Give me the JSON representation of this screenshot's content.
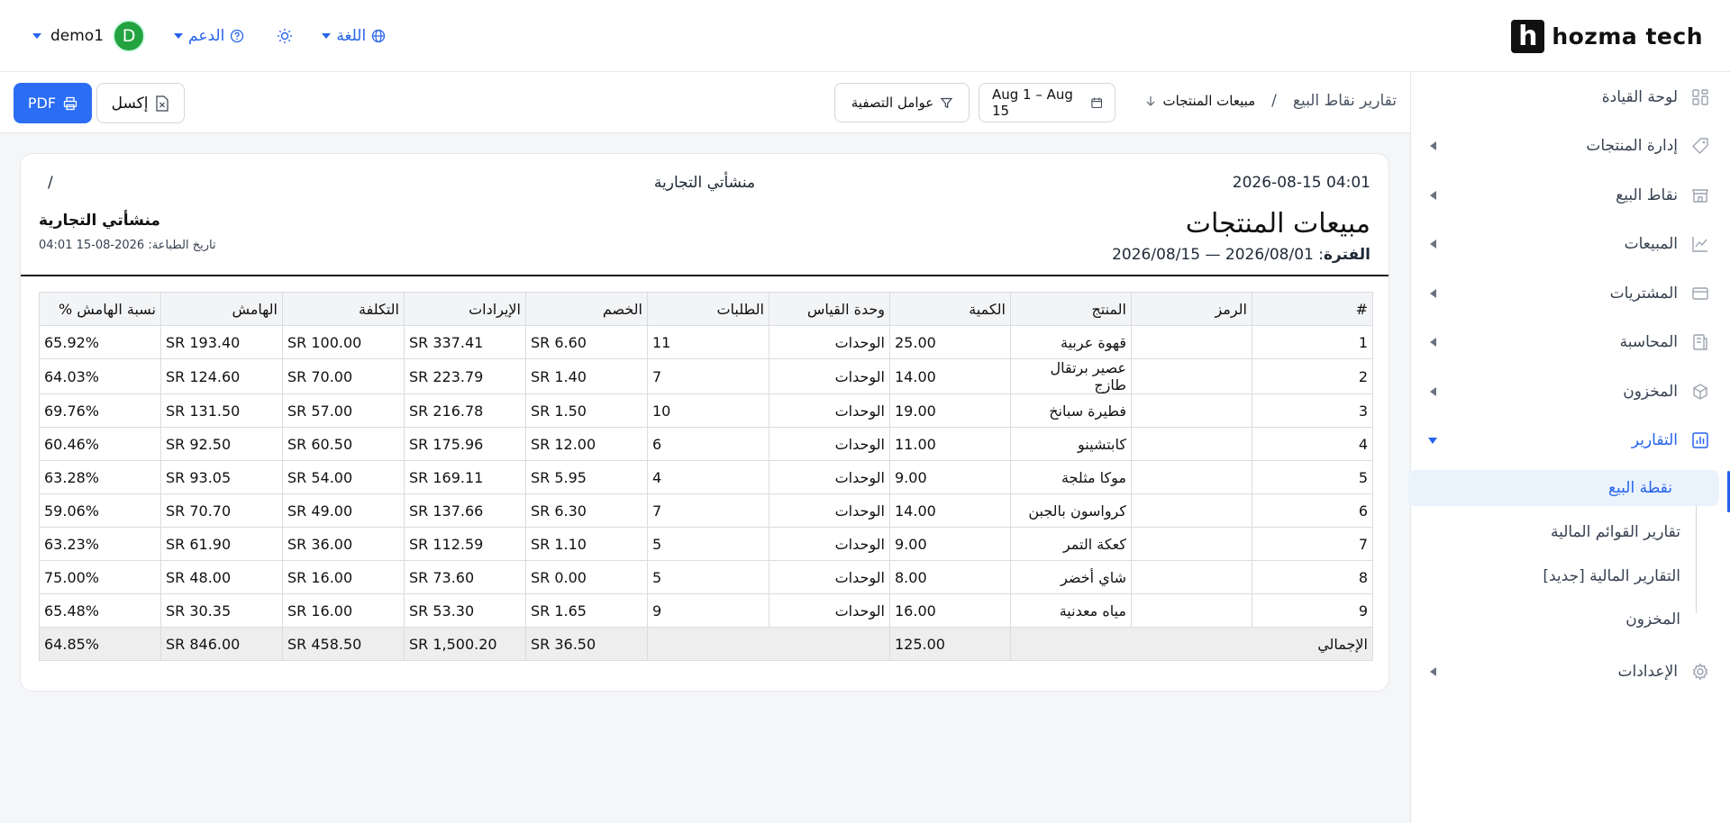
{
  "header": {
    "logo_letter": "h",
    "logo_text": "hozma tech",
    "user": "demo1",
    "avatar_letter": "D",
    "support": "الدعم",
    "language": "اللغة"
  },
  "sidebar": {
    "items": [
      {
        "label": "لوحة القيادة",
        "icon": "dashboard-icon"
      },
      {
        "label": "إدارة المنتجات",
        "icon": "tag-icon"
      },
      {
        "label": "نقاط البيع",
        "icon": "store-icon"
      },
      {
        "label": "المبيعات",
        "icon": "chart-line-icon"
      },
      {
        "label": "المشتريات",
        "icon": "card-icon"
      },
      {
        "label": "المحاسبة",
        "icon": "ledger-icon"
      },
      {
        "label": "المخزون",
        "icon": "box-icon"
      },
      {
        "label": "التقارير",
        "icon": "report-icon"
      },
      {
        "label": "الإعدادات",
        "icon": "gear-icon"
      }
    ],
    "sub_items": [
      "نقطة البيع",
      "تقارير القوائم المالية",
      "التقارير المالية [جديد]",
      "المخزون"
    ]
  },
  "toolbar": {
    "breadcrumb_root": "تقارير نقاط البيع",
    "breadcrumb_sep": "/",
    "breadcrumb_current": "مبيعات المنتجات",
    "date_range": "Aug 1 – Aug 15",
    "filters": "عوامل التصفية",
    "excel": "إكسل",
    "pdf": "PDF"
  },
  "report": {
    "print_datetime": "2026-08-15 04:01",
    "company_center": "منشأتي التجارية",
    "slash": "/",
    "title": "مبيعات المنتجات",
    "period_label": "الفترة",
    "period_value": ": 2026/08/01 — 2026/08/15",
    "company": "منشأتي التجارية",
    "print_date": "تاريخ الطباعة: 2026-08-15 04:01",
    "columns": [
      "#",
      "الرمز",
      "المنتج",
      "الكمية",
      "وحدة القياس",
      "الطلبات",
      "الخصم",
      "الإيرادات",
      "التكلفة",
      "الهامش",
      "نسبة الهامش %"
    ],
    "rows": [
      [
        "1",
        "",
        "قهوة عربية",
        "25.00",
        "الوحدات",
        "11",
        "SR 6.60",
        "SR 337.41",
        "SR 100.00",
        "SR 193.40",
        "65.92%"
      ],
      [
        "2",
        "",
        "عصير برتقال طازج",
        "14.00",
        "الوحدات",
        "7",
        "SR 1.40",
        "SR 223.79",
        "SR 70.00",
        "SR 124.60",
        "64.03%"
      ],
      [
        "3",
        "",
        "فطيرة سبانخ",
        "19.00",
        "الوحدات",
        "10",
        "SR 1.50",
        "SR 216.78",
        "SR 57.00",
        "SR 131.50",
        "69.76%"
      ],
      [
        "4",
        "",
        "كابتشينو",
        "11.00",
        "الوحدات",
        "6",
        "SR 12.00",
        "SR 175.96",
        "SR 60.50",
        "SR 92.50",
        "60.46%"
      ],
      [
        "5",
        "",
        "موكا مثلجة",
        "9.00",
        "الوحدات",
        "4",
        "SR 5.95",
        "SR 169.11",
        "SR 54.00",
        "SR 93.05",
        "63.28%"
      ],
      [
        "6",
        "",
        "كرواسون بالجبن",
        "14.00",
        "الوحدات",
        "7",
        "SR 6.30",
        "SR 137.66",
        "SR 49.00",
        "SR 70.70",
        "59.06%"
      ],
      [
        "7",
        "",
        "كعكة التمر",
        "9.00",
        "الوحدات",
        "5",
        "SR 1.10",
        "SR 112.59",
        "SR 36.00",
        "SR 61.90",
        "63.23%"
      ],
      [
        "8",
        "",
        "شاي أخضر",
        "8.00",
        "الوحدات",
        "5",
        "SR 0.00",
        "SR 73.60",
        "SR 16.00",
        "SR 48.00",
        "75.00%"
      ],
      [
        "9",
        "",
        "مياه معدنية",
        "16.00",
        "الوحدات",
        "9",
        "SR 1.65",
        "SR 53.30",
        "SR 16.00",
        "SR 30.35",
        "65.48%"
      ]
    ],
    "total": {
      "label": "الإجمالي",
      "quantity": "125.00",
      "discount": "SR 36.50",
      "revenue": "SR 1,500.20",
      "cost": "SR 458.50",
      "margin": "SR 846.00",
      "margin_pct": "64.85%"
    }
  }
}
